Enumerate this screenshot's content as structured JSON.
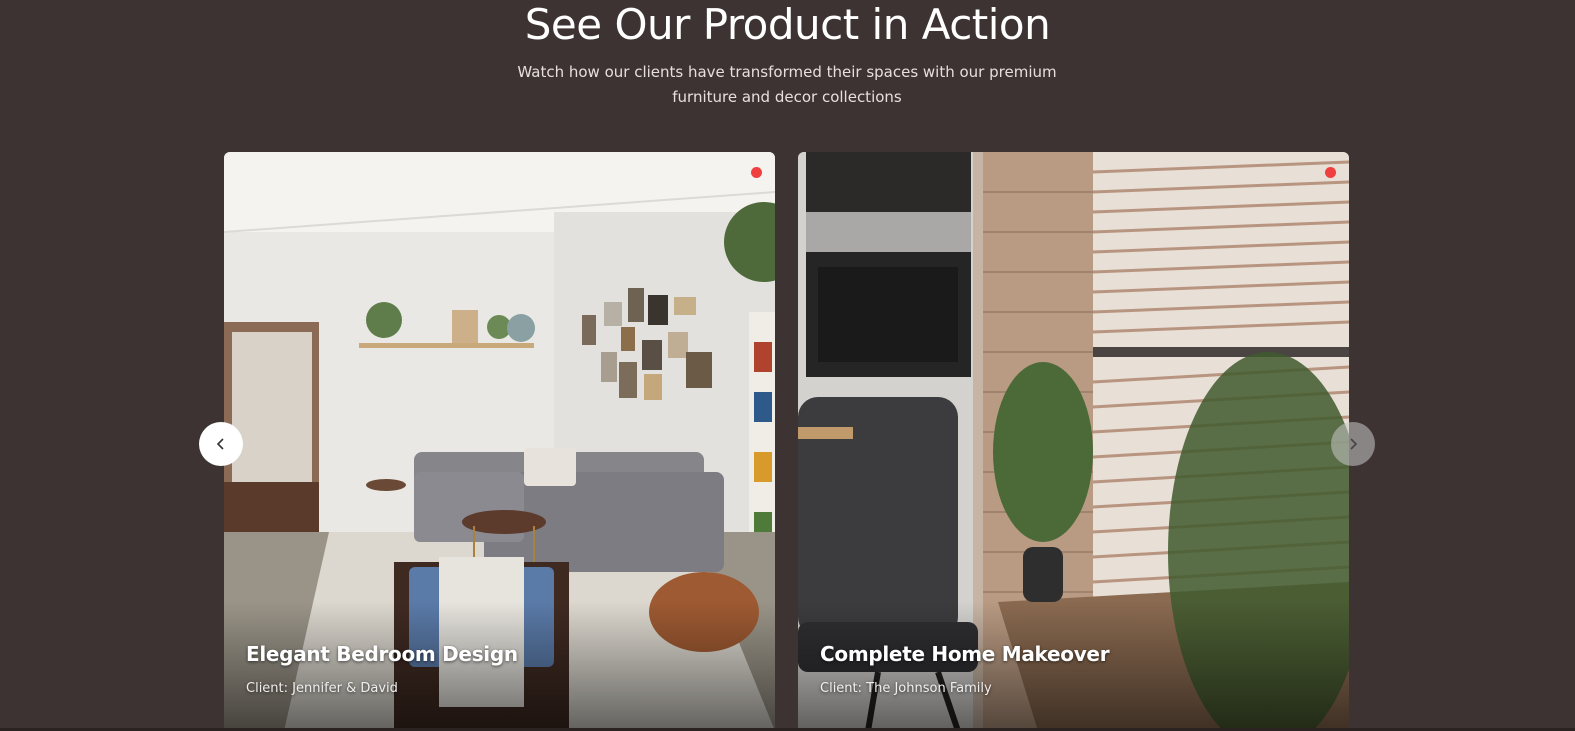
{
  "section": {
    "title": "See Our Product in Action",
    "subtitle": "Watch how our clients have transformed their spaces with our premium furniture and decor collections"
  },
  "cards": [
    {
      "title": "Elegant Bedroom Design",
      "client": "Client: Jennifer & David",
      "thumbnail": "living-room-photo",
      "indicator_color": "#ef3f3f"
    },
    {
      "title": "Complete Home Makeover",
      "client": "Client: The Johnson Family",
      "thumbnail": "kitchen-window-photo",
      "indicator_color": "#ef3f3f"
    }
  ],
  "carousel": {
    "prev_icon": "chevron-left-icon",
    "next_icon": "chevron-right-icon"
  },
  "colors": {
    "background": "#3d3332",
    "text": "#ffffff",
    "indicator": "#ef3f3f"
  }
}
